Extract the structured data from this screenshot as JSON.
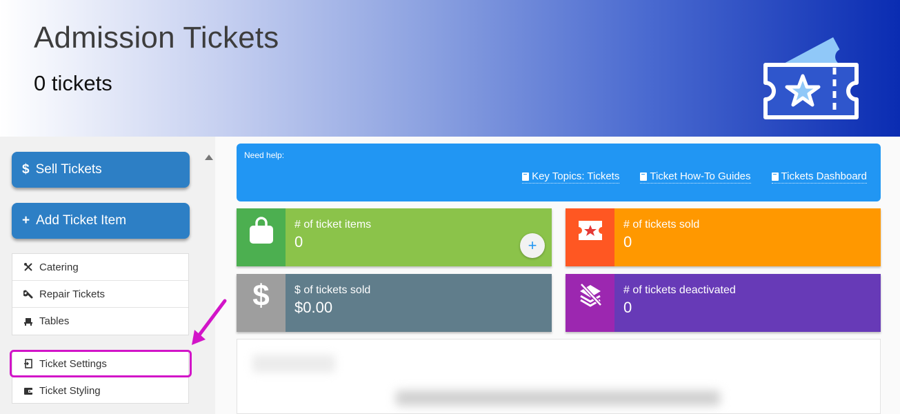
{
  "header": {
    "title": "Admission Tickets",
    "count": "0 tickets",
    "logo_icon": "ticket-star-icon",
    "gradient_end": "#0a2cb2"
  },
  "sidebar": {
    "sell_button": {
      "icon": "$",
      "label": "Sell Tickets"
    },
    "add_button": {
      "icon": "+",
      "label": "Add Ticket Item"
    },
    "menu_group_1": [
      {
        "icon": "fork-knife-icon",
        "label": "Catering"
      },
      {
        "icon": "wrench-icon",
        "label": "Repair Tickets"
      },
      {
        "icon": "chair-icon",
        "label": "Tables"
      }
    ],
    "menu_group_2": [
      {
        "icon": "settings-door-icon",
        "label": "Ticket Settings"
      },
      {
        "icon": "wallet-icon",
        "label": "Ticket Styling"
      }
    ],
    "highlight_color": "#d214c8"
  },
  "help": {
    "title": "Need help:",
    "links": [
      "Key Topics: Tickets",
      "Ticket How-To Guides",
      "Tickets Dashboard"
    ],
    "color": "#2196f3"
  },
  "stats": [
    {
      "label": "# of ticket items",
      "value": "0",
      "icon": "shopping-bag-icon",
      "icon_bg": "#4caf50",
      "body_bg": "#8bc34a"
    },
    {
      "label": "# of tickets sold",
      "value": "0",
      "icon": "ticket-star-icon",
      "icon_bg": "#ff5722",
      "body_bg": "#ff9800"
    },
    {
      "label": "$ of tickets sold",
      "value": "$0.00",
      "icon": "dollar-icon",
      "icon_bg": "#9e9e9e",
      "body_bg": "#607d8b"
    },
    {
      "label": "# of tickets deactivated",
      "value": "0",
      "icon": "layers-off-icon",
      "icon_bg": "#9c27b0",
      "body_bg": "#673ab7"
    }
  ],
  "add_item_glyph": "+"
}
